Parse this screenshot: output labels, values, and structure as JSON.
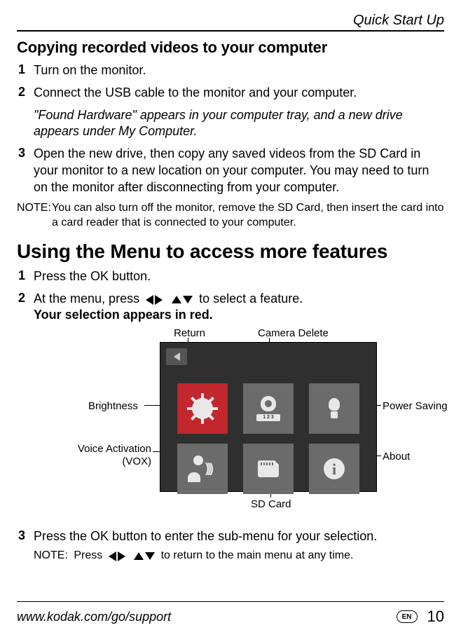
{
  "header": {
    "section": "Quick Start Up"
  },
  "h2a": "Copying recorded videos to your computer",
  "copy_steps": [
    {
      "n": "1",
      "text": "Turn on the monitor."
    },
    {
      "n": "2",
      "text": "Connect the USB cable to the monitor and your computer.",
      "sub_italic": "\"Found Hardware\" appears in your computer tray, and a new drive appears under My Computer."
    },
    {
      "n": "3",
      "text": "Open the new drive, then copy any saved videos from the SD Card in your monitor to a new location on your computer. You may need to turn on the monitor after disconnecting from your computer."
    }
  ],
  "copy_note": {
    "label": "NOTE:",
    "text": "You can also turn off the monitor, remove the SD Card, then insert the card into a card reader that is connected to your computer."
  },
  "h1": "Using the Menu to access more features",
  "menu_steps": {
    "s1": {
      "n": "1",
      "text": "Press the OK button."
    },
    "s2": {
      "n": "2",
      "prefix": "At the menu, press",
      "suffix": "to select a feature.",
      "bold_line": "Your selection appears in red."
    },
    "s3": {
      "n": "3",
      "text": "Press the OK button to enter the sub-menu for your selection.",
      "note_label": "NOTE:",
      "note_prefix": "Press",
      "note_suffix": "to return to the main menu at any time."
    }
  },
  "menu_labels": {
    "return": "Return",
    "camera_delete": "Camera Delete",
    "brightness": "Brightness",
    "vox_line1": "Voice Activation",
    "vox_line2": "(VOX)",
    "power_saving": "Power Saving",
    "about": "About",
    "sd_card": "SD Card"
  },
  "cam_bar": "1 2 3",
  "info_glyph": "i",
  "footer": {
    "url": "www.kodak.com/go/support",
    "lang": "EN",
    "page": "10"
  }
}
